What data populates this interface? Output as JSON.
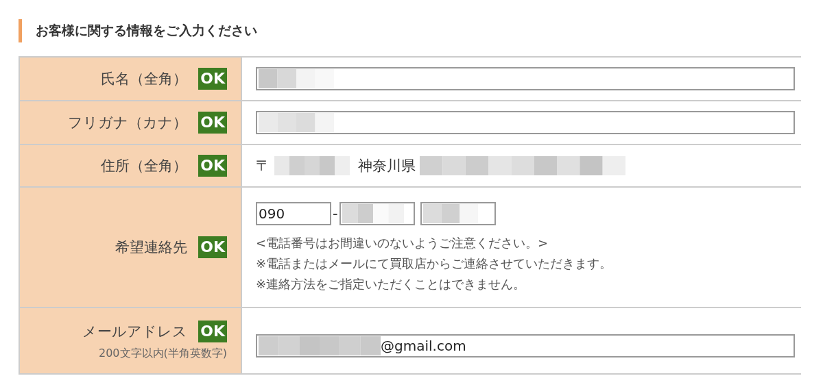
{
  "heading": "お客様に関する情報をご入力ください",
  "rows": [
    {
      "kind": "text",
      "label": "氏名（全角）",
      "badge": "OK",
      "valid": true
    },
    {
      "kind": "text",
      "label": "フリガナ（カナ）",
      "badge": "OK",
      "valid": true
    },
    {
      "kind": "address",
      "label": "住所（全角）",
      "badge": "OK",
      "valid": true,
      "postal_mark": "〒",
      "prefecture": "神奈川県"
    },
    {
      "kind": "phone",
      "label": "希望連絡先",
      "badge": "OK",
      "valid": true,
      "phone_1": "090",
      "separator": "-",
      "notes": [
        "<電話番号はお間違いのないようご注意ください。>",
        "※電話またはメールにて買取店からご連絡させていただきます。",
        "※連絡方法をご指定いただくことはできません。"
      ]
    },
    {
      "kind": "email",
      "label": "メールアドレス",
      "sublabel": "200文字以内(半角英数字)",
      "badge": "OK",
      "valid": true,
      "email_domain": "@gmail.com"
    }
  ]
}
